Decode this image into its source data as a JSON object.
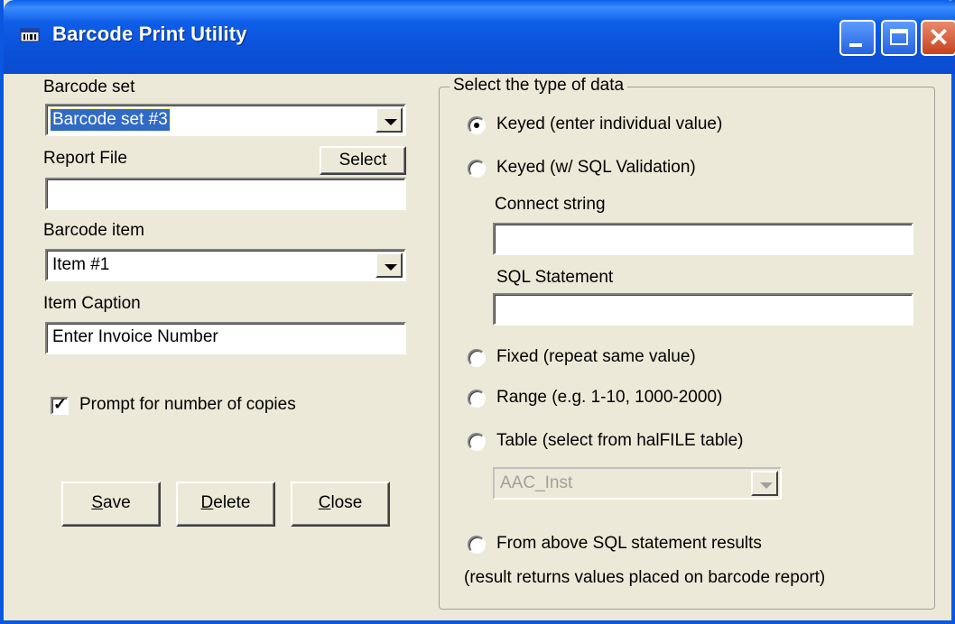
{
  "window": {
    "title": "Barcode Print Utility"
  },
  "left": {
    "barcode_set_label": "Barcode set",
    "barcode_set_value": "Barcode set #3",
    "report_file_label": "Report File",
    "select_button": "Select",
    "report_file_value": "",
    "barcode_item_label": "Barcode item",
    "barcode_item_value": "Item #1",
    "item_caption_label": "Item Caption",
    "item_caption_value": "Enter Invoice Number",
    "prompt_copies_label": "Prompt for number of copies",
    "prompt_copies_checked": true
  },
  "buttons": {
    "save": {
      "accel": "S",
      "rest": "ave"
    },
    "delete": {
      "accel": "D",
      "rest": "elete"
    },
    "close": {
      "accel": "C",
      "rest": "lose"
    }
  },
  "group": {
    "title": "Select the type of data",
    "options": [
      {
        "label": "Keyed (enter individual value)",
        "selected": true
      },
      {
        "label": "Keyed (w/ SQL Validation)",
        "selected": false
      },
      {
        "label": "Fixed (repeat same value)",
        "selected": false
      },
      {
        "label": "Range (e.g. 1-10, 1000-2000)",
        "selected": false
      },
      {
        "label": "Table (select from halFILE table)",
        "selected": false
      },
      {
        "label": "From above SQL statement results",
        "selected": false
      }
    ],
    "connect_string_label": "Connect string",
    "connect_string_value": "",
    "sql_statement_label": "SQL Statement",
    "sql_statement_value": "",
    "table_combo_value": "AAC_Inst",
    "footnote": "(result returns values placed on barcode report)"
  }
}
